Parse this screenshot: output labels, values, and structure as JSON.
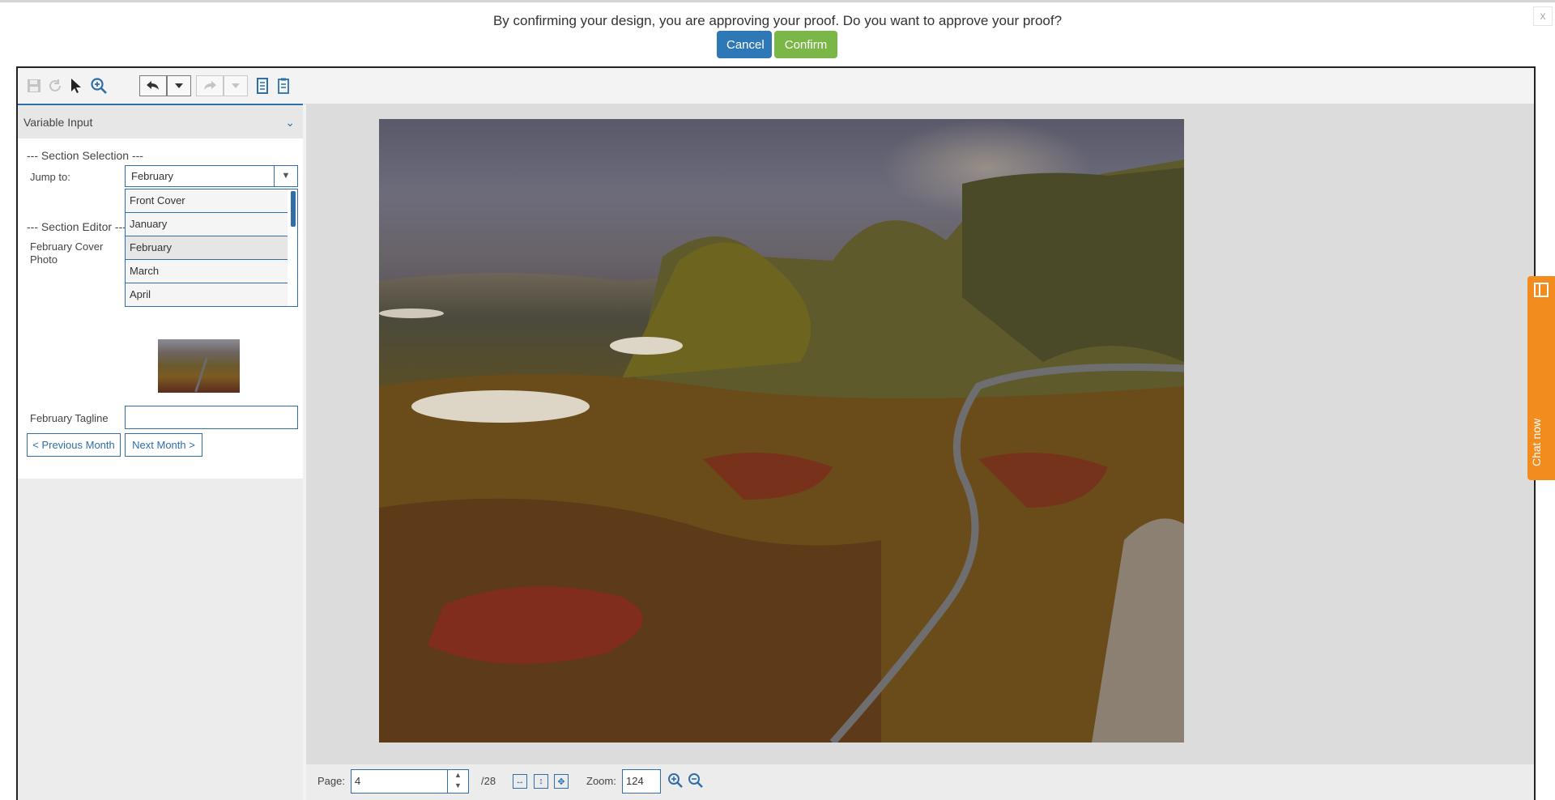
{
  "confirm_dialog": {
    "message": "By confirming your design, you are approving your proof. Do you want to approve your proof?",
    "cancel_label": "Cancel",
    "confirm_label": "Confirm",
    "close_label": "x"
  },
  "panel": {
    "title": "Variable Input",
    "section_selection_legend": "--- Section Selection ---",
    "jump_to_label": "Jump to:",
    "jump_to_value": "February",
    "dropdown_options": [
      "Front Cover",
      "January",
      "February",
      "March",
      "April"
    ],
    "selected_option": "February",
    "section_editor_legend": "--- Section Editor ---",
    "cover_photo_label_1": "February Cover",
    "cover_photo_label_2": "Photo",
    "tagline_label": "February Tagline",
    "tagline_value": "",
    "prev_button": "< Previous Month",
    "next_button": "Next Month >"
  },
  "bottom_bar": {
    "page_label": "Page:",
    "page_value": "4",
    "page_total": "/28",
    "zoom_label": "Zoom:",
    "zoom_value": "124"
  },
  "chat": {
    "label": "Chat now"
  },
  "colors": {
    "accent_blue": "#2f6ea8",
    "cancel_blue": "#2f78b7",
    "confirm_green": "#7ab648",
    "chat_orange": "#f28c1e"
  }
}
